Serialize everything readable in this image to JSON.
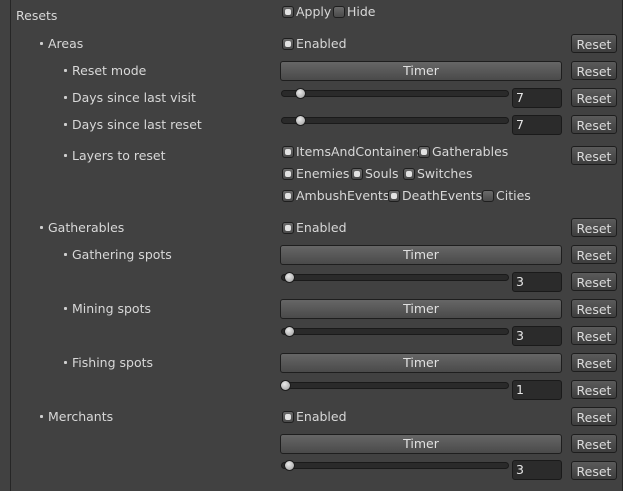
{
  "root": {
    "label": "Resets",
    "apply": "Apply",
    "apply_checked": true,
    "hide": "Hide",
    "hide_checked": false
  },
  "reset_label": "Reset",
  "areas": {
    "label": "Areas",
    "enabled": "Enabled",
    "enabled_checked": true,
    "reset_mode_label": "Reset mode",
    "reset_mode_value": "Timer",
    "days_visit_label": "Days since last visit",
    "days_visit_value": "7",
    "days_reset_label": "Days since last reset",
    "days_reset_value": "7",
    "layers_label": "Layers to reset",
    "layers": [
      {
        "label": "ItemsAndContainers",
        "checked": true
      },
      {
        "label": "Gatherables",
        "checked": true
      },
      {
        "label": "Enemies",
        "checked": true
      },
      {
        "label": "Souls",
        "checked": true
      },
      {
        "label": "Switches",
        "checked": true
      },
      {
        "label": "AmbushEvents",
        "checked": true
      },
      {
        "label": "DeathEvents",
        "checked": true
      },
      {
        "label": "Cities",
        "checked": false
      }
    ]
  },
  "gatherables": {
    "label": "Gatherables",
    "enabled": "Enabled",
    "enabled_checked": true,
    "gathering_label": "Gathering spots",
    "gathering_mode": "Timer",
    "gathering_value": "3",
    "mining_label": "Mining spots",
    "mining_mode": "Timer",
    "mining_value": "3",
    "fishing_label": "Fishing spots",
    "fishing_mode": "Timer",
    "fishing_value": "1"
  },
  "merchants": {
    "label": "Merchants",
    "enabled": "Enabled",
    "enabled_checked": true,
    "mode": "Timer",
    "value": "3"
  }
}
